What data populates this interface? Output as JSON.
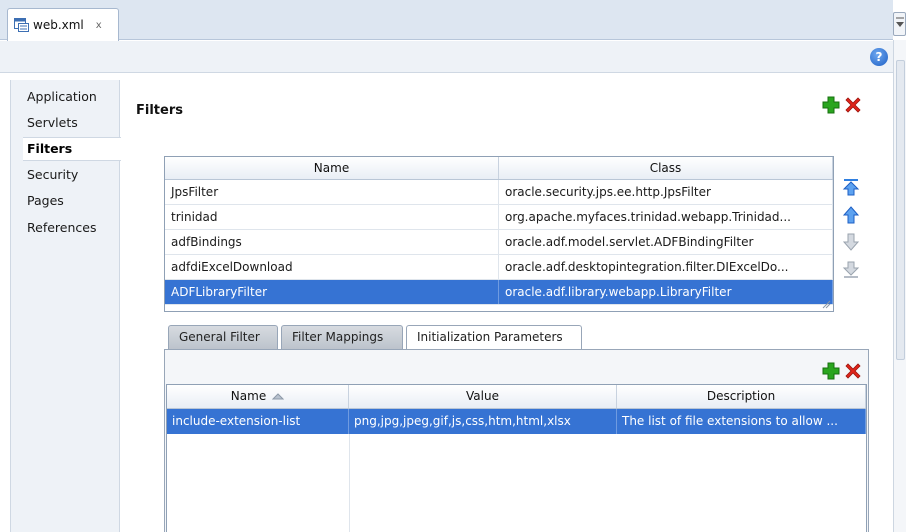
{
  "editor": {
    "tab_label": "web.xml",
    "tab_close": "x"
  },
  "help": {
    "label": "?"
  },
  "nav": {
    "items": [
      "Application",
      "Servlets",
      "Filters",
      "Security",
      "Pages",
      "References"
    ],
    "selected": "Filters"
  },
  "filters": {
    "title": "Filters",
    "columns": [
      "Name",
      "Class"
    ],
    "rows": [
      {
        "name": "JpsFilter",
        "class": "oracle.security.jps.ee.http.JpsFilter"
      },
      {
        "name": "trinidad",
        "class": "org.apache.myfaces.trinidad.webapp.Trinidad..."
      },
      {
        "name": "adfBindings",
        "class": "oracle.adf.model.servlet.ADFBindingFilter"
      },
      {
        "name": "adfdiExcelDownload",
        "class": "oracle.adf.desktopintegration.filter.DIExcelDo..."
      },
      {
        "name": "ADFLibraryFilter",
        "class": "oracle.adf.library.webapp.LibraryFilter"
      }
    ],
    "selected_row": 4
  },
  "detail_tabs": {
    "items": [
      "General Filter",
      "Filter Mappings",
      "Initialization Parameters"
    ],
    "active": "Initialization Parameters"
  },
  "init_params": {
    "columns": [
      "Name",
      "Value",
      "Description"
    ],
    "sort_column": "Name",
    "rows": [
      {
        "name": "include-extension-list",
        "value": "png,jpg,jpeg,gif,js,css,htm,html,xlsx",
        "description": "The list of file extensions to allow ..."
      }
    ]
  },
  "colors": {
    "selection": "#3673d3",
    "add_green": "#2aa51f",
    "delete_red": "#e0251b",
    "arrow_blue": "#2f7fe0",
    "arrow_disabled": "#b5bcc6"
  }
}
